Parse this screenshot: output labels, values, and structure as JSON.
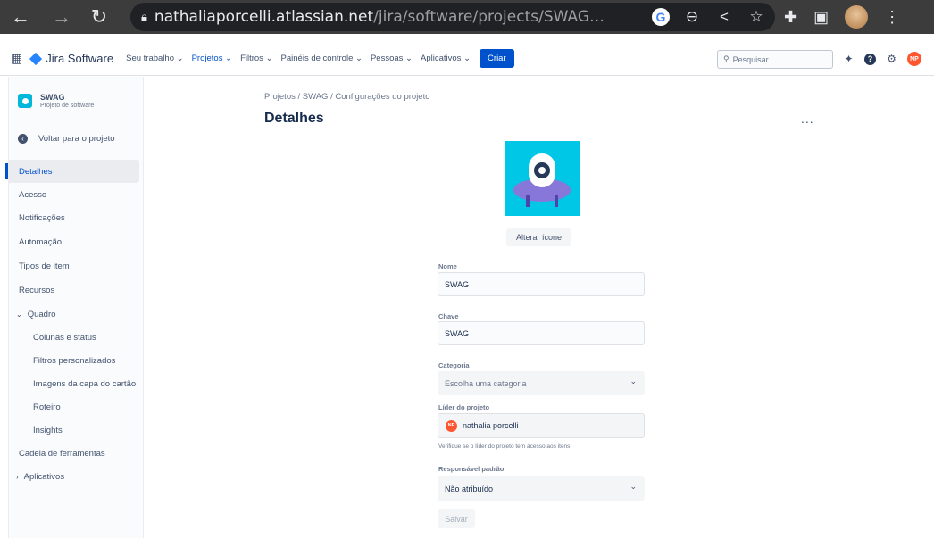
{
  "browser": {
    "url_host": "nathaliaporcelli.atlassian.net",
    "url_path": "/jira/software/projects/SWAG…"
  },
  "topnav": {
    "product": "Jira Software",
    "items": [
      "Seu trabalho",
      "Projetos",
      "Filtros",
      "Painéis de controle",
      "Pessoas",
      "Aplicativos"
    ],
    "create_label": "Criar",
    "search_placeholder": "Pesquisar",
    "user_initials": "NP"
  },
  "sidebar": {
    "project_name": "SWAG",
    "project_type": "Projeto de software",
    "back_label": "Voltar para o projeto",
    "items": [
      "Detalhes",
      "Acesso",
      "Notificações",
      "Automação",
      "Tipos de item",
      "Recursos"
    ],
    "board_label": "Quadro",
    "board_items": [
      "Colunas e status",
      "Filtros personalizados",
      "Imagens da capa do cartão",
      "Roteiro",
      "Insights"
    ],
    "toolchain": "Cadeia de ferramentas",
    "apps": "Aplicativos"
  },
  "main": {
    "breadcrumb": "Projetos  /  SWAG  /  Configurações do projeto",
    "title": "Detalhes",
    "more": "...",
    "change_icon": "Alterar ícone",
    "name_label": "Nome",
    "name_value": "SWAG",
    "key_label": "Chave",
    "key_value": "SWAG",
    "category_label": "Categoria",
    "category_placeholder": "Escolha uma categoria",
    "lead_label": "Líder do projeto",
    "lead_initials": "NP",
    "lead_value": "nathalia porcelli",
    "lead_help": "Verifique se o líder do projeto tem acesso aos itens.",
    "assignee_label": "Responsável padrão",
    "assignee_value": "Não atribuído",
    "save_label": "Salvar"
  },
  "colors": {
    "accent": "#0052cc",
    "project_icon_bg": "#00c7e6",
    "avatar": "#ff5630"
  }
}
